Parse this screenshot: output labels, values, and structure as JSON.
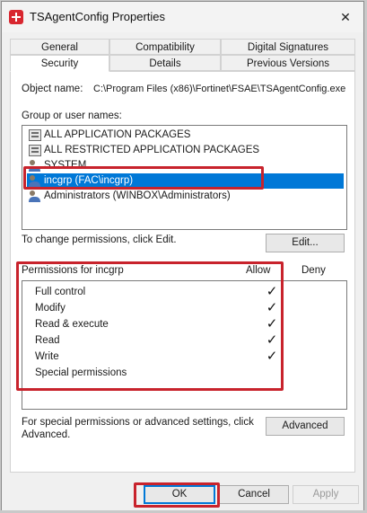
{
  "window": {
    "title": "TSAgentConfig Properties",
    "close_glyph": "✕"
  },
  "tabs": [
    {
      "label": "General"
    },
    {
      "label": "Compatibility"
    },
    {
      "label": "Digital Signatures"
    },
    {
      "label": "Security",
      "active": true
    },
    {
      "label": "Details"
    },
    {
      "label": "Previous Versions"
    }
  ],
  "security": {
    "object_label": "Object name:",
    "object_value": "C:\\Program Files (x86)\\Fortinet\\FSAE\\TSAgentConfig.exe",
    "group_label": "Group or user names:",
    "groups": [
      {
        "name": "ALL APPLICATION PACKAGES",
        "icon": "package-icon"
      },
      {
        "name": "ALL RESTRICTED APPLICATION PACKAGES",
        "icon": "package-icon"
      },
      {
        "name": "SYSTEM",
        "icon": "users-icon"
      },
      {
        "name": "incgrp (FAC\\incgrp)",
        "icon": "users-icon",
        "selected": true
      },
      {
        "name": "Administrators (WINBOX\\Administrators)",
        "icon": "users-icon"
      }
    ],
    "change_hint": "To change permissions, click Edit.",
    "edit_label": "Edit...",
    "perm_header": "Permissions for incgrp",
    "allow_label": "Allow",
    "deny_label": "Deny",
    "permissions": [
      {
        "name": "Full control",
        "allow": true
      },
      {
        "name": "Modify",
        "allow": true
      },
      {
        "name": "Read & execute",
        "allow": true
      },
      {
        "name": "Read",
        "allow": true
      },
      {
        "name": "Write",
        "allow": true
      },
      {
        "name": "Special permissions",
        "allow": false
      }
    ],
    "check_glyph": "✓",
    "advanced_hint_1": "For special permissions or advanced settings, click",
    "advanced_hint_2": "Advanced.",
    "advanced_label": "Advanced"
  },
  "footer": {
    "ok": "OK",
    "cancel": "Cancel",
    "apply": "Apply"
  },
  "colors": {
    "selection": "#0078d7",
    "highlight": "#c8232c"
  }
}
